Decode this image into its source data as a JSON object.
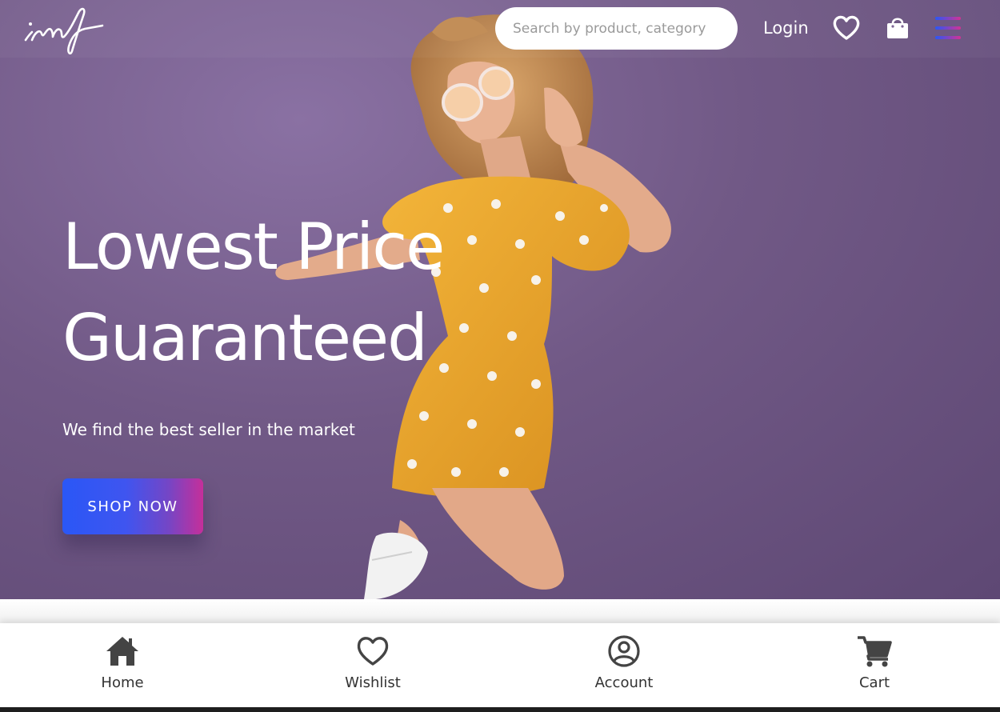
{
  "header": {
    "logo_text": "imf",
    "search_placeholder": "Search by product, category",
    "login_label": "Login",
    "icons": [
      "heart-icon",
      "shopping-bag-icon",
      "menu-icon"
    ]
  },
  "hero": {
    "headline_line1": "Lowest Price",
    "headline_line2": "Guaranteed",
    "subtitle": "We find the best seller in the market",
    "cta_label": "SHOP NOW"
  },
  "bottom_nav": {
    "home": "Home",
    "wishlist": "Wishlist",
    "account": "Account",
    "cart": "Cart"
  },
  "colors": {
    "hero_background": "#715986",
    "cta_gradient_start": "#2a57f6",
    "cta_gradient_end": "#c52f9a",
    "dress": "#f0aa30",
    "nav_icon": "#444444"
  }
}
